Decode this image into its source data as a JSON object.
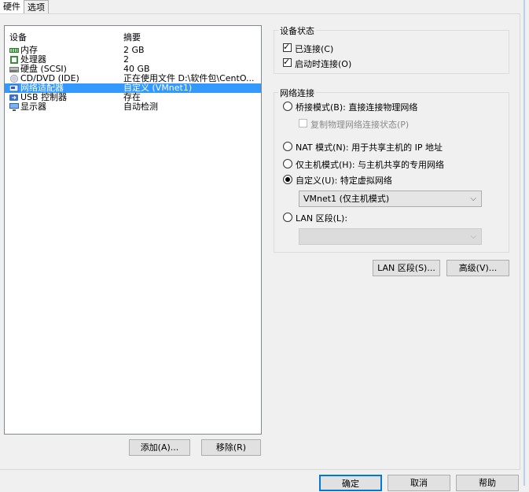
{
  "tabs": [
    {
      "label": "硬件"
    },
    {
      "label": "选项"
    }
  ],
  "device_list": {
    "header_device": "设备",
    "header_summary": "摘要",
    "rows": [
      {
        "name": "内存",
        "summary": "2 GB",
        "icon": "memory-icon"
      },
      {
        "name": "处理器",
        "summary": "2",
        "icon": "processor-icon"
      },
      {
        "name": "硬盘 (SCSI)",
        "summary": "40 GB",
        "icon": "harddisk-icon"
      },
      {
        "name": "CD/DVD (IDE)",
        "summary": "正在使用文件 D:\\软件包\\CentO...",
        "icon": "cdrom-icon"
      },
      {
        "name": "网络适配器",
        "summary": "自定义 (VMnet1)",
        "icon": "network-adapter-icon",
        "selected": true
      },
      {
        "name": "USB 控制器",
        "summary": "存在",
        "icon": "usb-icon"
      },
      {
        "name": "显示器",
        "summary": "自动检测",
        "icon": "monitor-icon"
      }
    ]
  },
  "buttons": {
    "add": "添加(A)...",
    "remove": "移除(R)",
    "lan_segments": "LAN 区段(S)...",
    "advanced": "高级(V)...",
    "ok": "确定",
    "cancel": "取消",
    "help": "帮助"
  },
  "device_status": {
    "title": "设备状态",
    "connected": {
      "label": "已连接(C)",
      "checked": true
    },
    "connect_at_power_on": {
      "label": "启动时连接(O)",
      "checked": true
    }
  },
  "network_connection": {
    "title": "网络连接",
    "bridged": {
      "label": "桥接模式(B): 直接连接物理网络",
      "selected": false
    },
    "replicate": {
      "label": "复制物理网络连接状态(P)",
      "checked": false,
      "enabled": false
    },
    "nat": {
      "label": "NAT 模式(N): 用于共享主机的 IP 地址",
      "selected": false
    },
    "host_only": {
      "label": "仅主机模式(H): 与主机共享的专用网络",
      "selected": false
    },
    "custom": {
      "label": "自定义(U): 特定虚拟网络",
      "selected": true
    },
    "custom_select_value": "VMnet1 (仅主机模式)",
    "lan_segment": {
      "label": "LAN 区段(L):",
      "selected": false
    },
    "lan_select_value": ""
  },
  "colors": {
    "selection": "#3399ff",
    "primary_border": "#0078d7",
    "window_bg": "#f0f0f0"
  }
}
